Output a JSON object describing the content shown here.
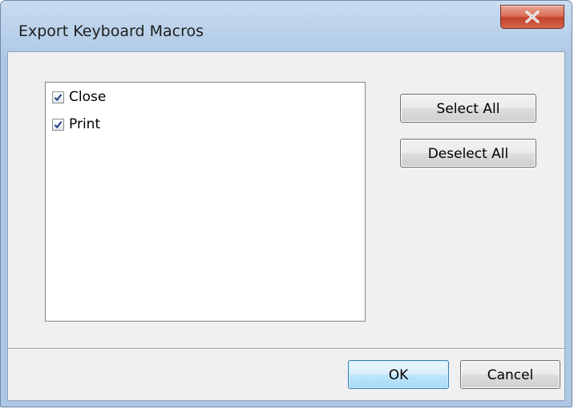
{
  "window": {
    "title": "Export Keyboard Macros",
    "close_icon": "close-icon"
  },
  "macro_list": {
    "items": [
      {
        "label": "Close",
        "checked": true
      },
      {
        "label": "Print",
        "checked": true
      }
    ]
  },
  "side_buttons": {
    "select_all": "Select All",
    "deselect_all": "Deselect All"
  },
  "footer": {
    "ok": "OK",
    "cancel": "Cancel"
  },
  "colors": {
    "title_bar": "#b9d1ea",
    "close_button": "#c2432c",
    "default_button_accent": "#3c7fb1",
    "check_mark": "#1d3f7a"
  }
}
